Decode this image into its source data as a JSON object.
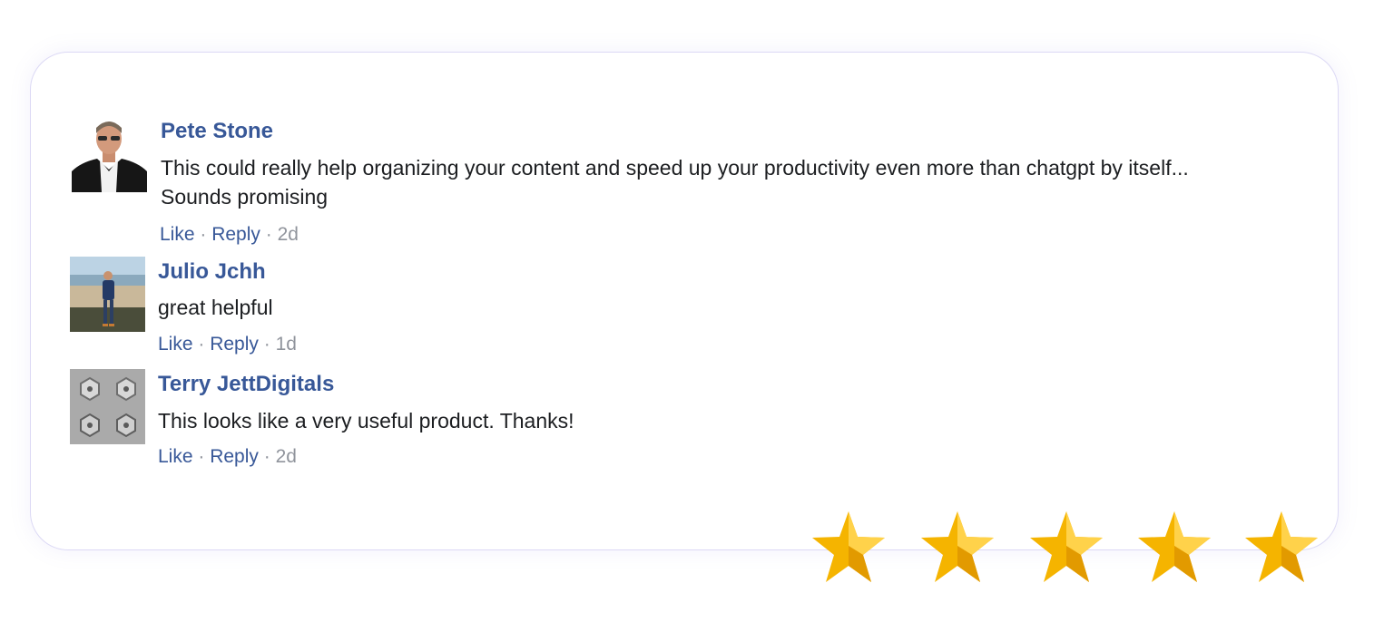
{
  "comments": [
    {
      "author": "Pete Stone",
      "text_lines": [
        "This could really help organizing your content and speed up your productivity even more than chatgpt by itself...",
        "Sounds promising"
      ],
      "like_label": "Like",
      "reply_label": "Reply",
      "separator": "·",
      "time": "2d"
    },
    {
      "author": "Julio Jchh",
      "text_lines": [
        "great helpful"
      ],
      "like_label": "Like",
      "reply_label": "Reply",
      "separator": "·",
      "time": "1d"
    },
    {
      "author": "Terry JettDigitals",
      "text_lines": [
        "This looks like a very useful product. Thanks!"
      ],
      "like_label": "Like",
      "reply_label": "Reply",
      "separator": "·",
      "time": "2d"
    }
  ],
  "rating": {
    "stars": 5,
    "max": 5,
    "star_color": "#f5b400",
    "icon": "star-icon"
  },
  "colors": {
    "author": "#385898",
    "body_text": "#1c1e21",
    "meta": "#90949c",
    "card_border": "#dcd9f5"
  }
}
